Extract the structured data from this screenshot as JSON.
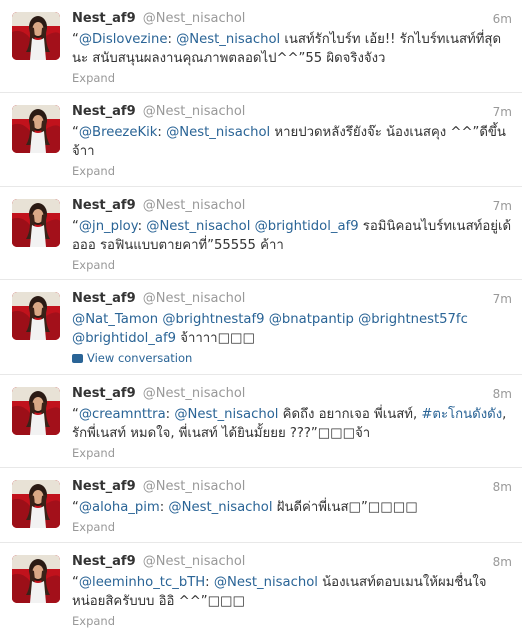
{
  "tweets": [
    {
      "fullname": "Nest_af9",
      "username": "@Nest_nisachol",
      "time": "6m",
      "parts": [
        {
          "t": "“",
          "c": "plain"
        },
        {
          "t": "@Dislovezine",
          "c": "mention"
        },
        {
          "t": ": ",
          "c": "plain"
        },
        {
          "t": "@Nest_nisachol",
          "c": "mention"
        },
        {
          "t": " เนสท์รักไบร์ท เอ้ย!! รักไบร์ทเนสท์ที่สุดนะ สนับสนุนผลงานคุณภาพตลอดไป^^”55 ผิดจริงจังว",
          "c": "plain"
        }
      ],
      "footer": "Expand"
    },
    {
      "fullname": "Nest_af9",
      "username": "@Nest_nisachol",
      "time": "7m",
      "parts": [
        {
          "t": "“",
          "c": "plain"
        },
        {
          "t": "@BreezeKik",
          "c": "mention"
        },
        {
          "t": ": ",
          "c": "plain"
        },
        {
          "t": "@Nest_nisachol",
          "c": "mention"
        },
        {
          "t": " หายปวดหลังรึยังจ๊ะ น้องเนสคุง ^^”ดีขึ้นจ้าา",
          "c": "plain"
        }
      ],
      "footer": "Expand"
    },
    {
      "fullname": "Nest_af9",
      "username": "@Nest_nisachol",
      "time": "7m",
      "parts": [
        {
          "t": "“",
          "c": "plain"
        },
        {
          "t": "@jn_ploy",
          "c": "mention"
        },
        {
          "t": ": ",
          "c": "plain"
        },
        {
          "t": "@Nest_nisachol",
          "c": "mention"
        },
        {
          "t": " ",
          "c": "plain"
        },
        {
          "t": "@brightidol_af9",
          "c": "mention"
        },
        {
          "t": " รอมินิคอนไบร์ทเนสท์อยู่เด้อออ รอฟินแบบตายคาที่”55555 ค้าา",
          "c": "plain"
        }
      ],
      "footer": "Expand"
    },
    {
      "fullname": "Nest_af9",
      "username": "@Nest_nisachol",
      "time": "7m",
      "parts": [
        {
          "t": "@Nat_Tamon",
          "c": "mention"
        },
        {
          "t": " ",
          "c": "plain"
        },
        {
          "t": "@brightnestaf9",
          "c": "mention"
        },
        {
          "t": " ",
          "c": "plain"
        },
        {
          "t": "@bnatpantip",
          "c": "mention"
        },
        {
          "t": " ",
          "c": "plain"
        },
        {
          "t": "@brightnest57fc",
          "c": "mention"
        },
        {
          "t": " ",
          "c": "plain"
        },
        {
          "t": "@brightidol_af9",
          "c": "mention"
        },
        {
          "t": " จ้าาาา□□□",
          "c": "plain"
        }
      ],
      "footer": "View conversation",
      "footer_is_convo": true
    },
    {
      "fullname": "Nest_af9",
      "username": "@Nest_nisachol",
      "time": "8m",
      "parts": [
        {
          "t": "“",
          "c": "plain"
        },
        {
          "t": "@creamnttra",
          "c": "mention"
        },
        {
          "t": ": ",
          "c": "plain"
        },
        {
          "t": "@Nest_nisachol",
          "c": "mention"
        },
        {
          "t": " คิดถึง อยากเจอ พี่เนสท์, ",
          "c": "plain"
        },
        {
          "t": "#ตะโกนดังดัง",
          "c": "hashtag"
        },
        {
          "t": ", รักพี่เนสท์ หมดใจ, พี่เนสท์ ได้ยินมั้ยยย ???”□□□จ้า",
          "c": "plain"
        }
      ],
      "footer": "Expand"
    },
    {
      "fullname": "Nest_af9",
      "username": "@Nest_nisachol",
      "time": "8m",
      "parts": [
        {
          "t": "“",
          "c": "plain"
        },
        {
          "t": "@aloha_pim",
          "c": "mention"
        },
        {
          "t": ": ",
          "c": "plain"
        },
        {
          "t": "@Nest_nisachol",
          "c": "mention"
        },
        {
          "t": " ฝันดีค่าพี่เนส□”□□□□",
          "c": "plain"
        }
      ],
      "footer": "Expand"
    },
    {
      "fullname": "Nest_af9",
      "username": "@Nest_nisachol",
      "time": "8m",
      "parts": [
        {
          "t": "“",
          "c": "plain"
        },
        {
          "t": "@leeminho_tc_bTH",
          "c": "mention"
        },
        {
          "t": ": ",
          "c": "plain"
        },
        {
          "t": "@Nest_nisachol",
          "c": "mention"
        },
        {
          "t": " น้องเนสท์ตอบเมนให้ผมชื่นใจหน่อยสิครับบบ อิอิ ^^”□□□",
          "c": "plain"
        }
      ],
      "footer": "Expand"
    }
  ]
}
